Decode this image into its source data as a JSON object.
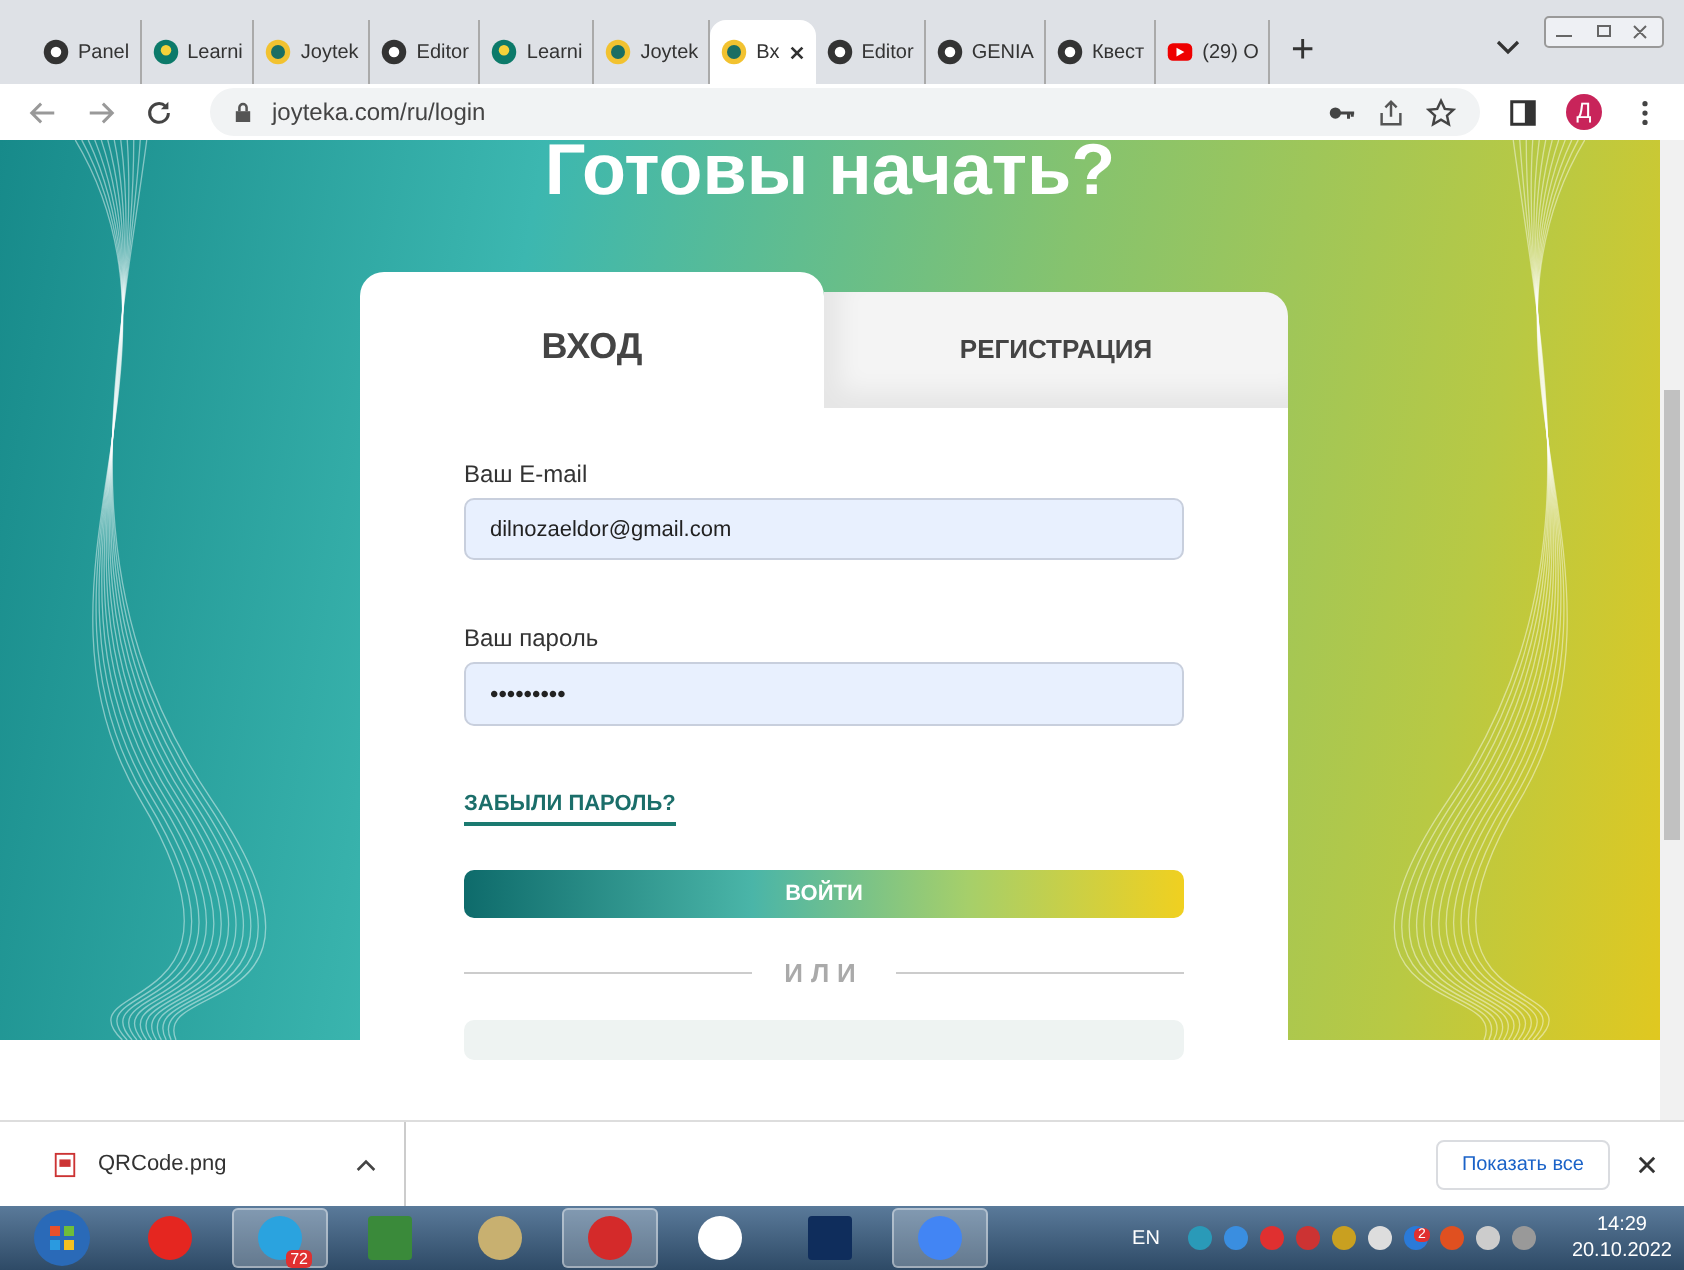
{
  "browser": {
    "tabs": [
      {
        "label": "Panel",
        "kind": "chrome",
        "selected": false
      },
      {
        "label": "Learni",
        "kind": "bulb",
        "selected": false
      },
      {
        "label": "Joytek",
        "kind": "joy",
        "selected": false
      },
      {
        "label": "Editor",
        "kind": "chrome",
        "selected": false
      },
      {
        "label": "Learni",
        "kind": "bulb",
        "selected": false
      },
      {
        "label": "Joytek",
        "kind": "joy",
        "selected": false
      },
      {
        "label": "Вх",
        "kind": "joy",
        "selected": true
      },
      {
        "label": "Editor",
        "kind": "chrome",
        "selected": false
      },
      {
        "label": "GENIA",
        "kind": "chrome",
        "selected": false
      },
      {
        "label": "Квест",
        "kind": "chrome",
        "selected": false
      },
      {
        "label": "(29) O",
        "kind": "youtube",
        "selected": false
      }
    ],
    "new_tab": "+",
    "url": "joyteka.com/ru/login",
    "profile": "Д"
  },
  "page": {
    "title": "Готовы начать?",
    "tabs": [
      {
        "label": "ВХОД",
        "selected": true
      },
      {
        "label": "РЕГИСТРАЦИЯ",
        "selected": false
      }
    ],
    "email_label": "Ваш E-mail",
    "email_value": "dilnozaeldor@gmail.com",
    "password_label": "Ваш пароль",
    "password_value": "•••••••••",
    "forgot_link": "ЗАБЫЛИ ПАРОЛЬ?",
    "login_button": "ВОЙТИ",
    "divider": "ИЛИ"
  },
  "downloads": {
    "file": "QRCode.png",
    "show_all": "Показать все"
  },
  "taskbar": {
    "apps": [
      {
        "kind": "yandex",
        "active": false
      },
      {
        "kind": "telegram",
        "active": true,
        "badge": "72"
      },
      {
        "kind": "camtasia",
        "active": false
      },
      {
        "kind": "paint",
        "active": false
      },
      {
        "kind": "wps",
        "active": true
      },
      {
        "kind": "ybrowser",
        "active": false
      },
      {
        "kind": "ps",
        "active": false
      },
      {
        "kind": "chrome",
        "active": true
      }
    ],
    "lang": "EN",
    "tray_badge": "2",
    "time": "14:29",
    "date": "20.10.2022"
  }
}
